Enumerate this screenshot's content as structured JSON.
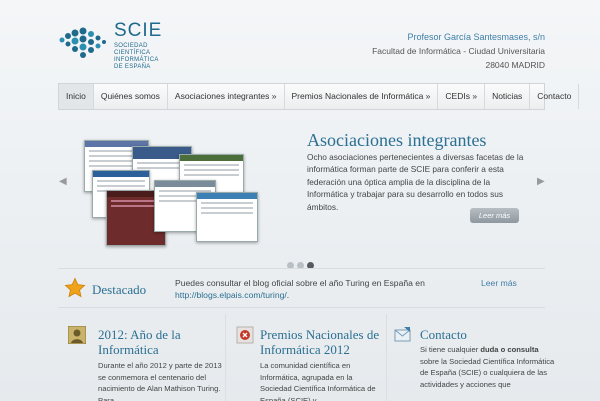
{
  "logo": {
    "title": "SCIE",
    "sub": [
      "SOCIEDAD",
      "CIENTÍFICA",
      "INFORMÁTICA",
      "DE ESPAÑA"
    ]
  },
  "address": [
    "Profesor García Santesmases, s/n",
    "Facultad de Informática - Ciudad Universitaria",
    "28040 MADRID"
  ],
  "nav": [
    {
      "label": "Inicio"
    },
    {
      "label": "Quiénes somos"
    },
    {
      "label": "Asociaciones integrantes »"
    },
    {
      "label": "Premios Nacionales de Informática »"
    },
    {
      "label": "CEDIs »"
    },
    {
      "label": "Noticias"
    },
    {
      "label": "Contacto"
    }
  ],
  "slider": {
    "title": "Asociaciones integrantes",
    "text": "Ocho asociaciones pertenecientes a diversas facetas de la informática forman parte de SCIE para conferir a esta federación una óptica amplia de la disciplina de la Informática y trabajar para su desarrollo en todos sus ámbitos.",
    "button": "Leer más",
    "prev": "◀",
    "next": "▶"
  },
  "featured": {
    "label": "Destacado",
    "text": "Puedes consultar el blog oficial sobre el año Turing en España en",
    "link": "http://blogs.elpais.com/turing/",
    "tail": ".",
    "more": "Leer más"
  },
  "columns": [
    {
      "title": "2012: Año de la Informática",
      "text": "Durante el año 2012 y parte de 2013 se conmemora el centenario del nacimiento de Alan Mathison Turing. Para"
    },
    {
      "title": "Premios Nacionales de Informática 2012",
      "text": "La comunidad científica en Informática, agrupada en la Sociedad Científica Informática de España (SCIE) y"
    },
    {
      "title": "Contacto",
      "text_pre": "Si tiene cualquier",
      "text_b1": "duda o consulta",
      "text_post": "sobre la Sociedad Científica Informática de España (SCIE) o cualquiera de las actividades y acciones que"
    }
  ],
  "colors": {
    "brand": "#2b6f92",
    "nav_bg": "#eceef0"
  }
}
